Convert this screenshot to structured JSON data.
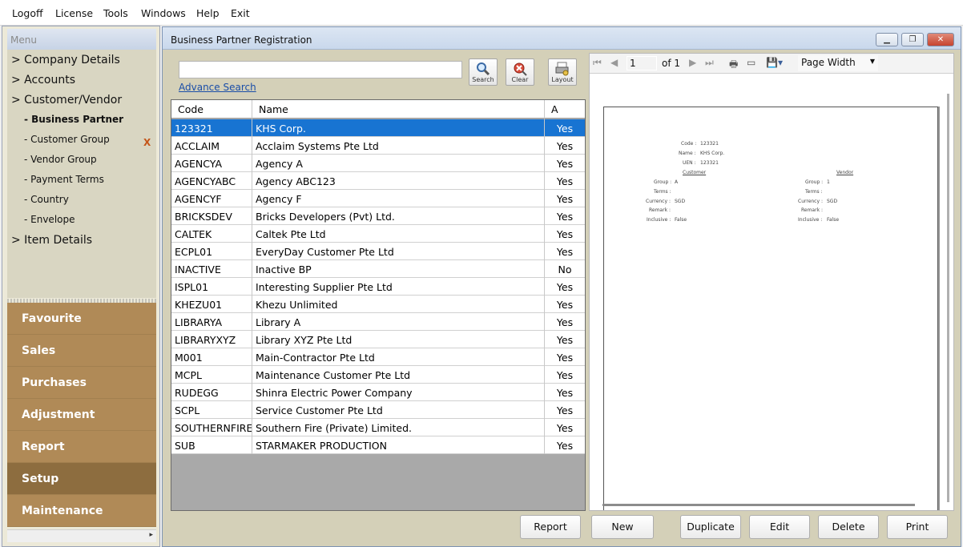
{
  "menubar": {
    "items": [
      "Logoff",
      "License",
      "Tools",
      "Windows",
      "Help",
      "Exit"
    ]
  },
  "leftnav": {
    "menu_title": "Menu",
    "tree": [
      {
        "label": "> Company Details"
      },
      {
        "label": "> Accounts"
      },
      {
        "label": "> Customer/Vendor"
      }
    ],
    "subitems": [
      {
        "label": "- Business Partner",
        "selected": true
      },
      {
        "label": "- Customer Group"
      },
      {
        "label": "- Vendor Group"
      },
      {
        "label": "- Payment Terms"
      },
      {
        "label": "- Country"
      },
      {
        "label": "- Envelope"
      }
    ],
    "item_details": "> Item Details",
    "close_mark": "X",
    "nav_buttons": [
      "Favourite",
      "Sales",
      "Purchases",
      "Adjustment",
      "Report",
      "Setup",
      "Maintenance"
    ],
    "active_nav": "Setup"
  },
  "window": {
    "title": "Business Partner Registration"
  },
  "search": {
    "value": "",
    "advance_link": "Advance Search",
    "buttons": {
      "search": "Search",
      "clear": "Clear",
      "layout": "Layout"
    }
  },
  "grid": {
    "columns": [
      "Code",
      "Name",
      "A"
    ],
    "rows": [
      {
        "code": "123321",
        "name": "KHS Corp.",
        "active": "Yes"
      },
      {
        "code": "ACCLAIM",
        "name": "Acclaim Systems Pte Ltd",
        "active": "Yes"
      },
      {
        "code": "AGENCYA",
        "name": "Agency A",
        "active": "Yes"
      },
      {
        "code": "AGENCYABC",
        "name": "Agency ABC123",
        "active": "Yes"
      },
      {
        "code": "AGENCYF",
        "name": "Agency F",
        "active": "Yes"
      },
      {
        "code": "BRICKSDEV",
        "name": "Bricks Developers (Pvt) Ltd.",
        "active": "Yes"
      },
      {
        "code": "CALTEK",
        "name": "Caltek Pte Ltd",
        "active": "Yes"
      },
      {
        "code": "ECPL01",
        "name": "EveryDay Customer Pte Ltd",
        "active": "Yes"
      },
      {
        "code": "INACTIVE",
        "name": "Inactive BP",
        "active": "No"
      },
      {
        "code": "ISPL01",
        "name": "Interesting Supplier Pte Ltd",
        "active": "Yes"
      },
      {
        "code": "KHEZU01",
        "name": "Khezu Unlimited",
        "active": "Yes"
      },
      {
        "code": "LIBRARYA",
        "name": "Library A",
        "active": "Yes"
      },
      {
        "code": "LIBRARYXYZ",
        "name": "Library XYZ Pte Ltd",
        "active": "Yes"
      },
      {
        "code": "M001",
        "name": "Main-Contractor Pte Ltd",
        "active": "Yes"
      },
      {
        "code": "MCPL",
        "name": "Maintenance Customer Pte Ltd",
        "active": "Yes"
      },
      {
        "code": "RUDEGG",
        "name": "Shinra Electric Power Company",
        "active": "Yes"
      },
      {
        "code": "SCPL",
        "name": "Service Customer Pte Ltd",
        "active": "Yes"
      },
      {
        "code": "SOUTHERNFIRE",
        "name": "Southern Fire (Private) Limited.",
        "active": "Yes"
      },
      {
        "code": "SUB",
        "name": "STARMAKER PRODUCTION",
        "active": "Yes"
      }
    ],
    "selected_index": 0
  },
  "viewer": {
    "page": "1",
    "of_label": "of",
    "total_pages": "1",
    "zoom": "Page Width",
    "report": {
      "code_label": "Code :",
      "code": "123321",
      "name_label": "Name :",
      "name": "KHS Corp.",
      "uen_label": "UEN :",
      "uen": "123321",
      "customer": {
        "heading": "Customer",
        "group_label": "Group :",
        "group": "A",
        "terms_label": "Terms :",
        "terms": "",
        "currency_label": "Currency :",
        "currency": "SGD",
        "remark_label": "Remark :",
        "remark": "",
        "inclusive_label": "Inclusive :",
        "inclusive": "False"
      },
      "vendor": {
        "heading": "Vendor",
        "group_label": "Group :",
        "group": "1",
        "terms_label": "Terms :",
        "terms": "",
        "currency_label": "Currency :",
        "currency": "SGD",
        "remark_label": "Remark :",
        "remark": "",
        "inclusive_label": "Inclusive :",
        "inclusive": "False"
      }
    }
  },
  "actions": {
    "report": "Report",
    "new": "New",
    "duplicate": "Duplicate",
    "edit": "Edit",
    "delete": "Delete",
    "print": "Print"
  },
  "colors": {
    "nav_button": "#b08a57",
    "nav_active": "#8d6d3f",
    "selected_row": "#1874d2"
  }
}
